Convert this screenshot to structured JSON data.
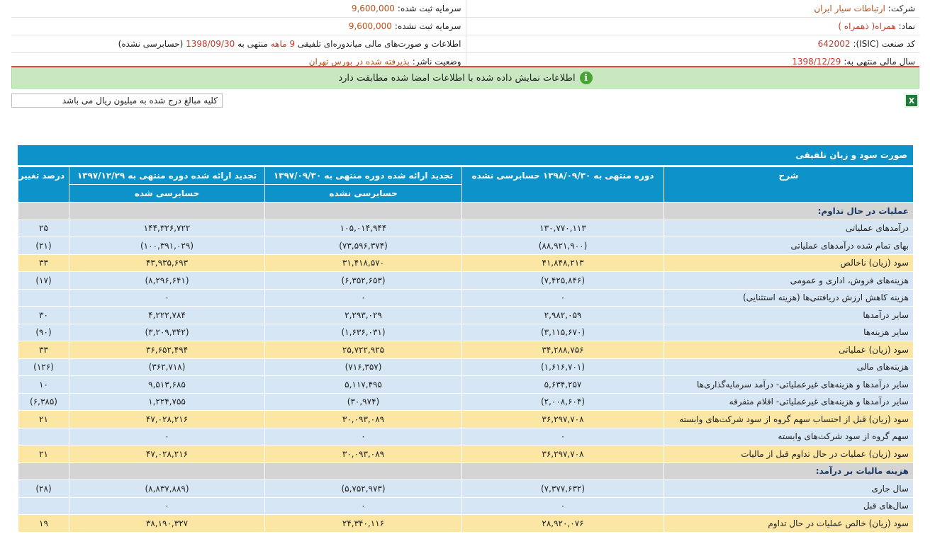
{
  "info": {
    "company_label": "شرکت:",
    "company_value": "ارتباطات سیار ایران",
    "reg_capital_label": "سرمایه ثبت شده:",
    "reg_capital_value": "9,600,000",
    "symbol_label": "نماد:",
    "symbol_value": "همراه( ذهمراه )",
    "unreg_capital_label": "سرمایه ثبت نشده:",
    "unreg_capital_value": "9,600,000",
    "isic_label": "کد صنعت (ISIC):",
    "isic_value": "642002",
    "report_prefix": "اطلاعات و صورت‌های مالی میاندوره‌ای تلفیقی",
    "report_period": "9 ماهه",
    "report_mid": "منتهی به",
    "report_date": "1398/09/30",
    "report_suffix": "(حسابرسی نشده)",
    "fiscal_label": "سال مالی منتهی به:",
    "fiscal_value": "1398/12/29",
    "status_label": "وضعیت ناشر:",
    "status_value": "پذیرفته شده در بورس تهران"
  },
  "notice": {
    "icon": "i",
    "text": "اطلاعات نمایش داده شده با اطلاعات امضا شده مطابقت دارد"
  },
  "unit_note": "کلیه مبالغ درج شده به میلیون ریال می باشد",
  "excel_icon": "X",
  "table": {
    "title": "صورت سود و زیان تلفیقی",
    "headers": {
      "desc": "شرح",
      "col1": "دوره منتهی به ۱۳۹۸/۰۹/۳۰ حسابرسی نشده",
      "col2": "تجدید ارائه شده دوره منتهی به ۱۳۹۷/۰۹/۳۰",
      "col2_sub": "حسابرسی نشده",
      "col3": "تجدید ارائه شده دوره منتهی به ۱۳۹۷/۱۲/۲۹",
      "col3_sub": "حسابرسی شده",
      "col4": "درصد تغییر"
    },
    "rows": [
      {
        "type": "section",
        "label": "عملیات در حال تداوم:"
      },
      {
        "type": "light",
        "label": "درآمدهای عملیاتی",
        "c1": "۱۳۰,۷۷۰,۱۱۳",
        "c2": "۱۰۵,۰۱۴,۹۴۴",
        "c3": "۱۴۴,۳۲۶,۷۲۲",
        "c4": "۲۵"
      },
      {
        "type": "light",
        "label": "بهای تمام شده درآمدهای عملیاتی",
        "c1": "(۸۸,۹۲۱,۹۰۰)",
        "c2": "(۷۳,۵۹۶,۳۷۴)",
        "c3": "(۱۰۰,۳۹۱,۰۲۹)",
        "c4": "(۲۱)",
        "neg": true
      },
      {
        "type": "yellow",
        "label": "سود (زیان) ناخالص",
        "c1": "۴۱,۸۴۸,۲۱۳",
        "c2": "۳۱,۴۱۸,۵۷۰",
        "c3": "۴۳,۹۳۵,۶۹۳",
        "c4": "۳۳"
      },
      {
        "type": "light",
        "label": "هزینه‌های فروش، اداری و عمومی",
        "c1": "(۷,۴۲۵,۸۴۶)",
        "c2": "(۶,۳۵۲,۶۵۳)",
        "c3": "(۸,۲۹۶,۶۴۱)",
        "c4": "(۱۷)",
        "neg": true
      },
      {
        "type": "light",
        "label": "هزینه کاهش ارزش دریافتنی‌ها (هزینه استثنایی)",
        "c1": "۰",
        "c2": "۰",
        "c3": "۰",
        "c4": ""
      },
      {
        "type": "light",
        "label": "سایر درآمدها",
        "c1": "۲,۹۸۲,۰۵۹",
        "c2": "۲,۲۹۳,۰۲۹",
        "c3": "۴,۲۲۲,۷۸۴",
        "c4": "۳۰"
      },
      {
        "type": "light",
        "label": "سایر هزینه‌ها",
        "c1": "(۳,۱۱۵,۶۷۰)",
        "c2": "(۱,۶۳۶,۰۳۱)",
        "c3": "(۳,۲۰۹,۳۴۲)",
        "c4": "(۹۰)",
        "neg": true
      },
      {
        "type": "yellow",
        "label": "سود (زیان) عملیاتی",
        "c1": "۳۴,۲۸۸,۷۵۶",
        "c2": "۲۵,۷۲۲,۹۲۵",
        "c3": "۳۶,۶۵۲,۴۹۴",
        "c4": "۳۳"
      },
      {
        "type": "light",
        "label": "هزینه‌های مالی",
        "c1": "(۱,۶۱۶,۷۰۱)",
        "c2": "(۷۱۶,۳۵۷)",
        "c3": "(۳۶۲,۷۱۸)",
        "c4": "(۱۲۶)",
        "neg": true
      },
      {
        "type": "light",
        "label": "سایر درآمدها و هزینه‌های غیرعملیاتی- درآمد سرمایه‌گذاری‌ها",
        "c1": "۵,۶۳۴,۲۵۷",
        "c2": "۵,۱۱۷,۴۹۵",
        "c3": "۹,۵۱۳,۶۸۵",
        "c4": "۱۰"
      },
      {
        "type": "light",
        "label": "سایر درآمدها و هزینه‌های غیرعملیاتی- اقلام متفرقه",
        "c1": "(۲,۰۰۸,۶۰۴)",
        "c2": "(۳۰,۹۷۴)",
        "c3": "۱,۲۲۴,۷۵۵",
        "c4": "(۶,۳۸۵)",
        "neg": true,
        "c3pos": true
      },
      {
        "type": "yellow",
        "label": "سود (زیان) قبل از احتساب سهم گروه از سود شرکت‌های وابسته",
        "c1": "۳۶,۲۹۷,۷۰۸",
        "c2": "۳۰,۰۹۳,۰۸۹",
        "c3": "۴۷,۰۲۸,۲۱۶",
        "c4": "۲۱"
      },
      {
        "type": "light",
        "label": "سهم گروه از سود شرکت‌های وابسته",
        "c1": "۰",
        "c2": "۰",
        "c3": "۰",
        "c4": ""
      },
      {
        "type": "yellow",
        "label": "سود (زیان) عملیات در حال تداوم قبل از مالیات",
        "c1": "۳۶,۲۹۷,۷۰۸",
        "c2": "۳۰,۰۹۳,۰۸۹",
        "c3": "۴۷,۰۲۸,۲۱۶",
        "c4": "۲۱"
      },
      {
        "type": "section",
        "label": "هزینه مالیات بر درآمد:"
      },
      {
        "type": "light",
        "label": "سال جاری",
        "c1": "(۷,۳۷۷,۶۳۲)",
        "c2": "(۵,۷۵۲,۹۷۳)",
        "c3": "(۸,۸۳۷,۸۸۹)",
        "c4": "(۲۸)",
        "neg": true
      },
      {
        "type": "light",
        "label": "سال‌های قبل",
        "c1": "۰",
        "c2": "۰",
        "c3": "۰",
        "c4": ""
      },
      {
        "type": "yellow",
        "label": "سود (زیان) خالص عملیات در حال تداوم",
        "c1": "۲۸,۹۲۰,۰۷۶",
        "c2": "۲۴,۳۴۰,۱۱۶",
        "c3": "۳۸,۱۹۰,۳۲۷",
        "c4": "۱۹"
      }
    ]
  }
}
